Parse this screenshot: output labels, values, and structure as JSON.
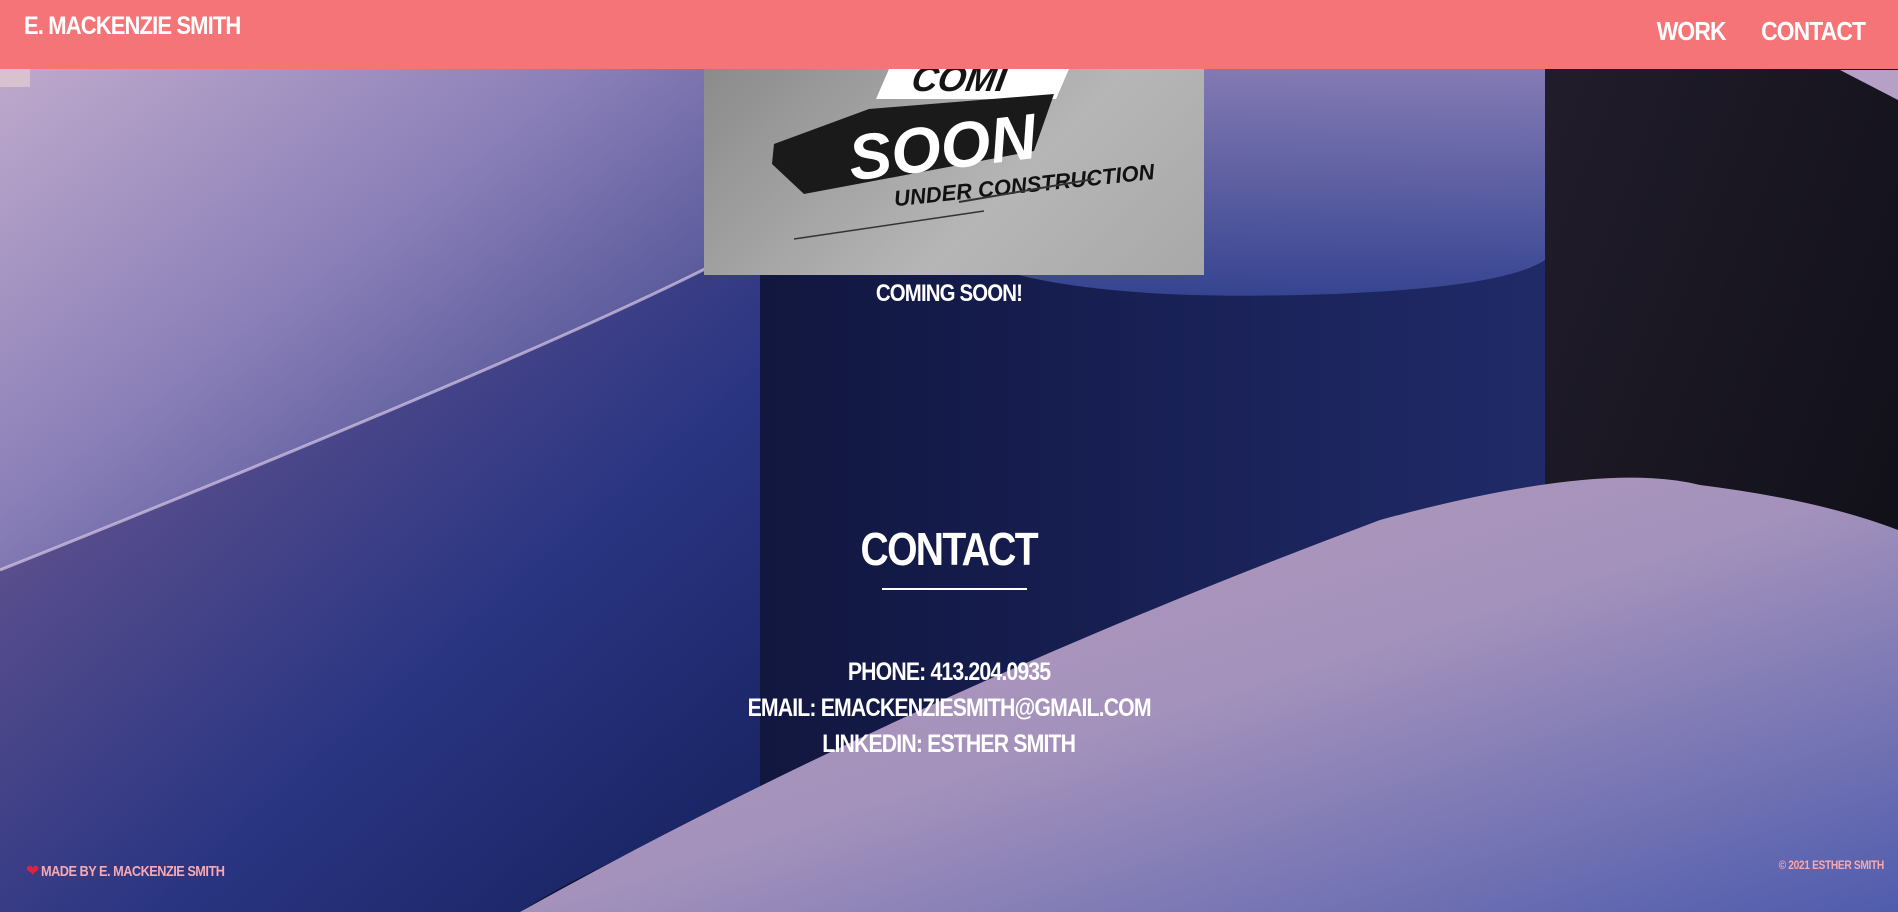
{
  "header": {
    "brand": "E. MACKENZIE SMITH",
    "nav": [
      {
        "label": "WORK"
      },
      {
        "label": "CONTACT"
      }
    ]
  },
  "hero": {
    "sign_top": "COMI",
    "sign_main": "SOON",
    "sign_sub": "UNDER CONSTRUCTION",
    "caption": "COMING SOON!"
  },
  "contact": {
    "title": "CONTACT",
    "phone": "PHONE: 413.204.0935",
    "email": "EMAIL: EMACKENZIESMITH@GMAIL.COM",
    "linkedin": "LINKEDIN: ESTHER SMITH"
  },
  "footer": {
    "made_by": "MADE BY E. MACKENZIE SMITH",
    "copyright": "© 2021 ESTHER SMITH"
  },
  "colors": {
    "header": "#f47478",
    "footer_text": "#f6a9b2",
    "heart": "#e3203d"
  }
}
